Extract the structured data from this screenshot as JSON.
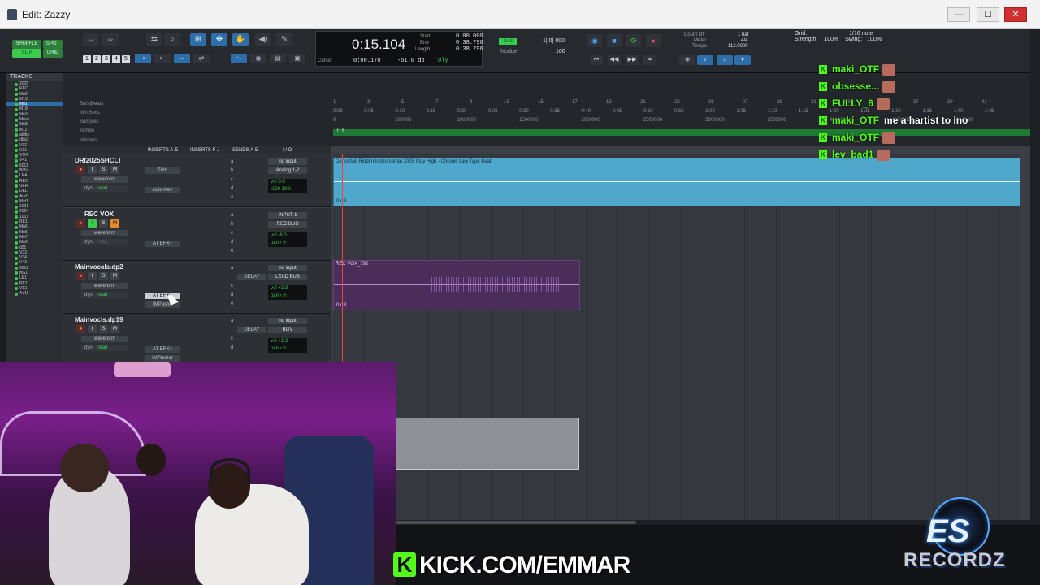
{
  "window": {
    "title": "Edit: Zazzy",
    "minimize": "—",
    "maximize": "☐",
    "close": "✕"
  },
  "toolbar": {
    "modes": {
      "shuffle": "SHUFFLE",
      "spot": "SPOT",
      "slip": "SLIP",
      "grid": "GRID"
    },
    "numbers": [
      "1",
      "2",
      "3",
      "4",
      "5"
    ],
    "counter": {
      "main": "0:15.104",
      "start_label": "Start",
      "start": "0:00.000",
      "end_label": "End",
      "end": "0:38.796",
      "length_label": "Length",
      "length": "0:38.796",
      "cursor_label": "Cursor",
      "cursor": "0:00.170",
      "db": "-51.0 db",
      "dly": "Dly"
    },
    "grid": {
      "badge": "Grid",
      "value": "1| 0| 000",
      "nudge_label": "Nudge",
      "nudge": "100"
    },
    "meter": {
      "count_off": "Count Off",
      "meter": "Meter",
      "tempo": "Tempo",
      "bar": "1 bar",
      "sig": "4/4",
      "bpm": "112.0000"
    },
    "quantize": {
      "grid": "Grid:",
      "note": "1/16 note",
      "strength": "Strength:",
      "strength_val": "100%",
      "swing": "Swing:",
      "swing_val": "100%"
    }
  },
  "tracks_panel": {
    "header": "TRACKS",
    "items": [
      "2025",
      "REC",
      "Mn2",
      "M19",
      "Mn1",
      "M18",
      "Mn3",
      "Mnvo",
      "Mn8",
      "M11",
      "adlbs",
      "dbs2",
      "V32",
      "V31",
      "VO4",
      "V41",
      "6011",
      "BOV",
      "LEA",
      "REC",
      "VER",
      "DEL",
      "Aud1",
      "Mst1",
      "1001",
      "2024",
      "1001",
      "RE1",
      "Mn6",
      "Mn5",
      "Mn7",
      "Mn9",
      "d21",
      "V33",
      "V34",
      "V43",
      "6011",
      "BG1",
      "LE1",
      "RE1",
      "VE1",
      "Ad11"
    ],
    "selected_index": 4
  },
  "rulers": {
    "labels": [
      "Bars|Beats",
      "Min:Secs",
      "Samples",
      "Tempo",
      "Markers"
    ],
    "bars": [
      "1",
      "3",
      "5",
      "7",
      "9",
      "13",
      "15",
      "17",
      "19",
      "21",
      "23",
      "25",
      "27",
      "29",
      "31",
      "33",
      "35",
      "37",
      "39",
      "41"
    ],
    "secs": [
      "0:03",
      "0:05",
      "0:10",
      "0:15",
      "0:20",
      "0:25",
      "0:30",
      "0:35",
      "0:40",
      "0:45",
      "0:50",
      "0:55",
      "1:00",
      "1:05",
      "1:10",
      "1:15",
      "1:20",
      "1:25",
      "1:30",
      "1:35",
      "1:40",
      "1:45"
    ],
    "samples": [
      "0",
      "500000",
      "1000000",
      "1500000",
      "2000000",
      "2500000",
      "3000000",
      "3500000",
      "4000000",
      "4500000",
      "5000000"
    ],
    "tempo_marker": "112"
  },
  "header_cols": {
    "inserts_ae": "INSERTS A-E",
    "inserts_fj": "INSERTS F-J",
    "sends_ae": "SENDS A-E",
    "io": "I / O"
  },
  "tracks": [
    {
      "name": "DRI2025SHCLT",
      "view": "waveform",
      "dyn": "dyn",
      "read": "read",
      "inserts": [
        "Trim",
        "Auto-Key"
      ],
      "io_in": "no input",
      "io_out": "Analog 1-2",
      "vol": "vol  0.0",
      "pan": "‹100  100›",
      "clip": "Dancehall Riddim Instrumental 2025 Stay High - Chronic Law Type Beat",
      "clip_db": "0 dB"
    },
    {
      "name": "REC VOX",
      "view": "waveform",
      "dyn": "dyn",
      "read": "read",
      "inserts": [
        "AT EFX+"
      ],
      "io_in": "INPUT 1",
      "io_out": "REC BUS",
      "vol": "vol  -6.0",
      "pan": "pan  ‹ 0 ›"
    },
    {
      "name": "Mainvocals.dp2",
      "view": "waveform",
      "dyn": "dyn",
      "read": "read",
      "inserts": [
        "AT EFX+",
        "IMPushe"
      ],
      "send": "DELAY",
      "io_in": "no input",
      "io_out": "LEAD BUS",
      "vol": "vol  +2.3",
      "pan": "pan  ‹ 0 ›",
      "clip": "REC VOX_792",
      "clip_db": "0 dB"
    },
    {
      "name": "Mainvocls.dp19",
      "view": "waveform",
      "dyn": "dyn",
      "read": "read",
      "inserts": [
        "AT EFX+",
        "IMPusher"
      ],
      "send": "DELAY",
      "io_in": "no input",
      "io_out": "BGV",
      "vol": "vol  +2.3",
      "pan": "pan  ‹ 0 ›"
    }
  ],
  "chat": [
    {
      "user": "maki_OTF",
      "msg": ""
    },
    {
      "user": "obsesse...",
      "msg": ""
    },
    {
      "user": "FULLY_6",
      "msg": ""
    },
    {
      "user": "maki_OTF",
      "msg": "me a hartist to ino"
    },
    {
      "user": "maki_OTF",
      "msg": ""
    },
    {
      "user": "lev_bad1",
      "msg": ""
    }
  ],
  "overlay": {
    "kick_k": "K",
    "kick_url": "KICK.COM/EMMAR",
    "logo_es": "ES",
    "logo_text": "RECORDZ"
  },
  "colors": {
    "accent_green": "#53fc18",
    "clip_blue": "#4fa8cc",
    "clip_purple": "#4b2d5a",
    "select_blue": "#2e6ea8"
  }
}
